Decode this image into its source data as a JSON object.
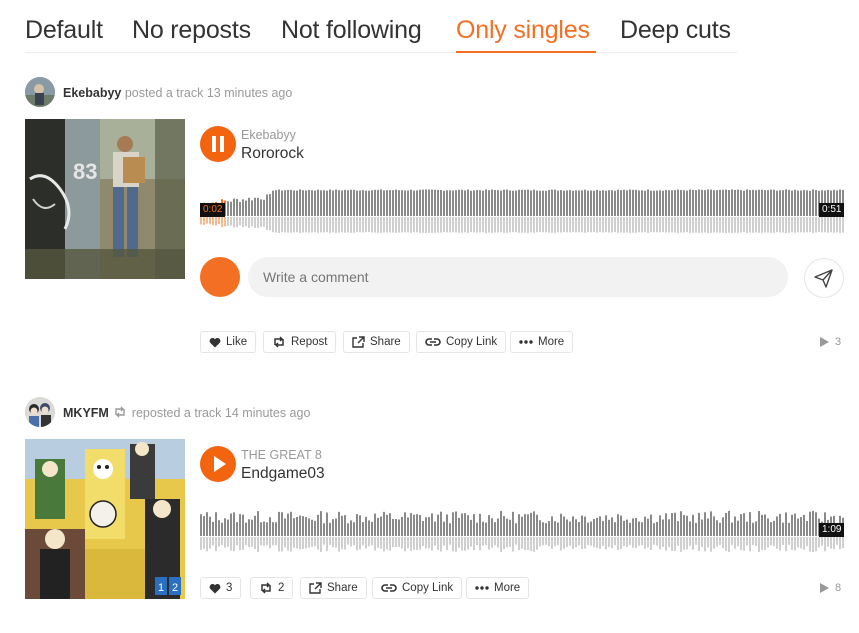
{
  "tabs": [
    {
      "label": "Default",
      "active": false
    },
    {
      "label": "No reposts",
      "active": false
    },
    {
      "label": "Not following",
      "active": false
    },
    {
      "label": "Only singles",
      "active": true
    },
    {
      "label": "Deep cuts",
      "active": false
    }
  ],
  "colors": {
    "accent": "#f26f23",
    "played": "#f26f23",
    "unplayed": "#999999"
  },
  "feed": [
    {
      "user": "Ekebabyy",
      "action": "posted a track",
      "time_ago": "13 minutes ago",
      "reposted": false,
      "track_user": "Ekebabyy",
      "track_title": "Rororock",
      "playing": true,
      "play_icon": "pause-icon",
      "elapsed": "0:02",
      "duration": "0:51",
      "progress": 0.04,
      "comment_placeholder": "Write a comment",
      "buttons": {
        "like": "Like",
        "repost": "Repost",
        "share": "Share",
        "copy": "Copy Link",
        "more": "More"
      },
      "plays": "3"
    },
    {
      "user": "MKYFM",
      "action": "reposted a track",
      "time_ago": "14 minutes ago",
      "reposted": true,
      "track_user": "THE GREAT 8",
      "track_title": "Endgame03",
      "playing": false,
      "play_icon": "play-icon",
      "duration": "1:09",
      "progress": 0,
      "buttons": {
        "like": "3",
        "repost": "2",
        "share": "Share",
        "copy": "Copy Link",
        "more": "More"
      },
      "plays": "8"
    }
  ]
}
